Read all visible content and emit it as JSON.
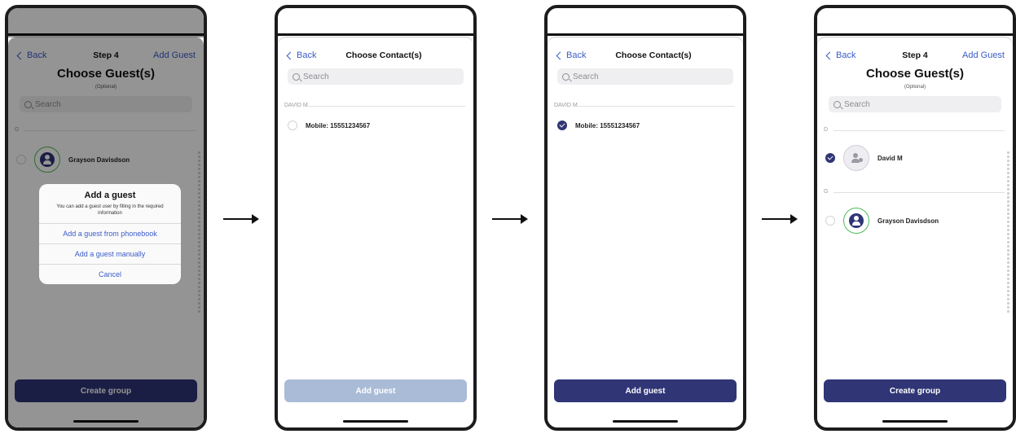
{
  "screens": [
    {
      "nav": {
        "back": "Back",
        "title": "Step 4",
        "action": "Add Guest"
      },
      "title": "Choose Guest(s)",
      "subtitle": "(Optional)",
      "search_placeholder": "Search",
      "section": "G",
      "guest": {
        "name": "Grayson Davisdson"
      },
      "alert": {
        "title": "Add a guest",
        "message": "You can add a guest user by filling in the required information",
        "options": [
          "Add a guest from phonebook",
          "Add a guest manually",
          "Cancel"
        ]
      },
      "button": "Create group"
    },
    {
      "nav": {
        "back": "Back",
        "title": "Choose Contact(s)"
      },
      "search_placeholder": "Search",
      "section": "DAVID M",
      "contact": {
        "label": "Mobile: 15551234567",
        "checked": false
      },
      "button": "Add guest"
    },
    {
      "nav": {
        "back": "Back",
        "title": "Choose Contact(s)"
      },
      "search_placeholder": "Search",
      "section": "DAVID M",
      "contact": {
        "label": "Mobile: 15551234567",
        "checked": true
      },
      "button": "Add guest"
    },
    {
      "nav": {
        "back": "Back",
        "title": "Step 4",
        "action": "Add Guest"
      },
      "title": "Choose Guest(s)",
      "subtitle": "(Optional)",
      "search_placeholder": "Search",
      "sections": [
        {
          "label": "D",
          "name": "David M",
          "checked": true
        },
        {
          "label": "G",
          "name": "Grayson Davisdson",
          "checked": false
        }
      ],
      "button": "Create group"
    }
  ],
  "colors": {
    "primary": "#2f3575",
    "link": "#3c5cc8",
    "disabled": "#a9bbd6",
    "avatar_ring": "#4dbd5a"
  }
}
